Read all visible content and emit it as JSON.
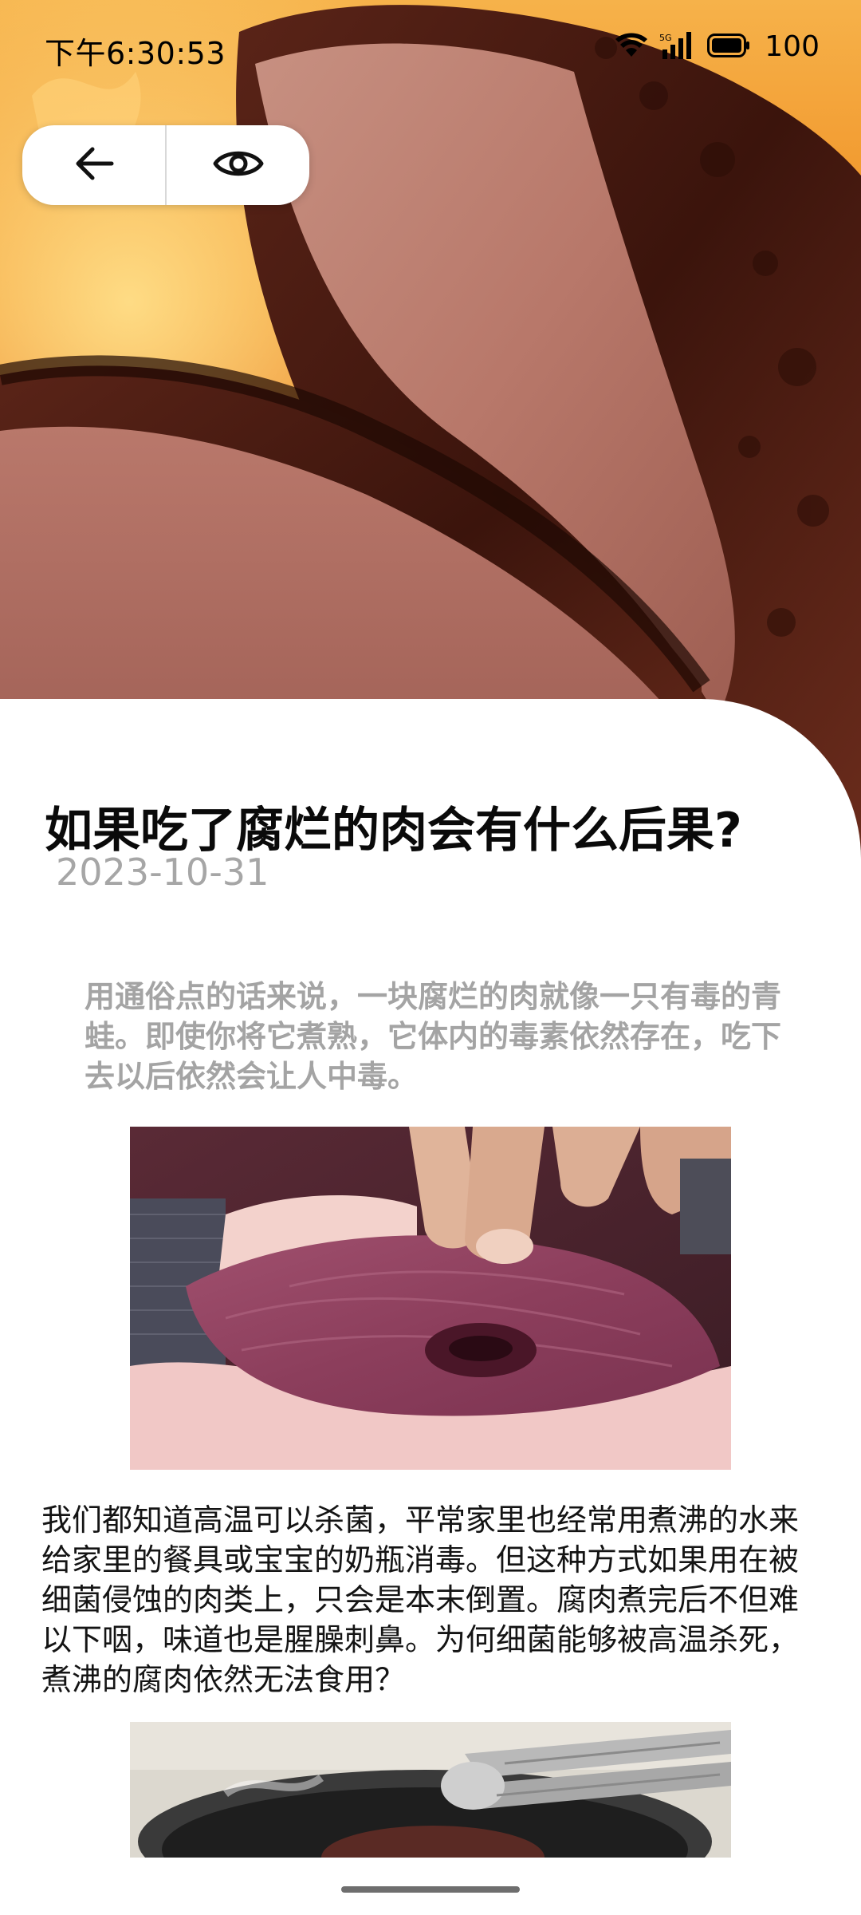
{
  "status_bar": {
    "time": "下午6:30:53",
    "network": "5G",
    "battery": "100"
  },
  "nav": {
    "back_icon": "arrow-left-icon",
    "view_icon": "eye-icon"
  },
  "article": {
    "title": "如果吃了腐烂的肉会有什么后果?",
    "date": "2023-10-31",
    "lead": "用通俗点的话来说，一块腐烂的肉就像一只有毒的青蛙。即使你将它煮熟，它体内的毒素依然存在，吃下去以后依然会让人中毒。",
    "body": "我们都知道高温可以杀菌，平常家里也经常用煮沸的水来给家里的餐具或宝宝的奶瓶消毒。但这种方式如果用在被细菌侵蚀的肉类上，只会是本末倒置。腐肉煮完后不但难以下咽，味道也是腥臊刺鼻。为何细菌能够被高温杀死，煮沸的腐肉依然无法食用？"
  },
  "colors": {
    "title": "#0a0a0a",
    "date": "#a6a6a6",
    "lead": "#a4a4a4",
    "body": "#141414",
    "sheet": "#ffffff"
  }
}
